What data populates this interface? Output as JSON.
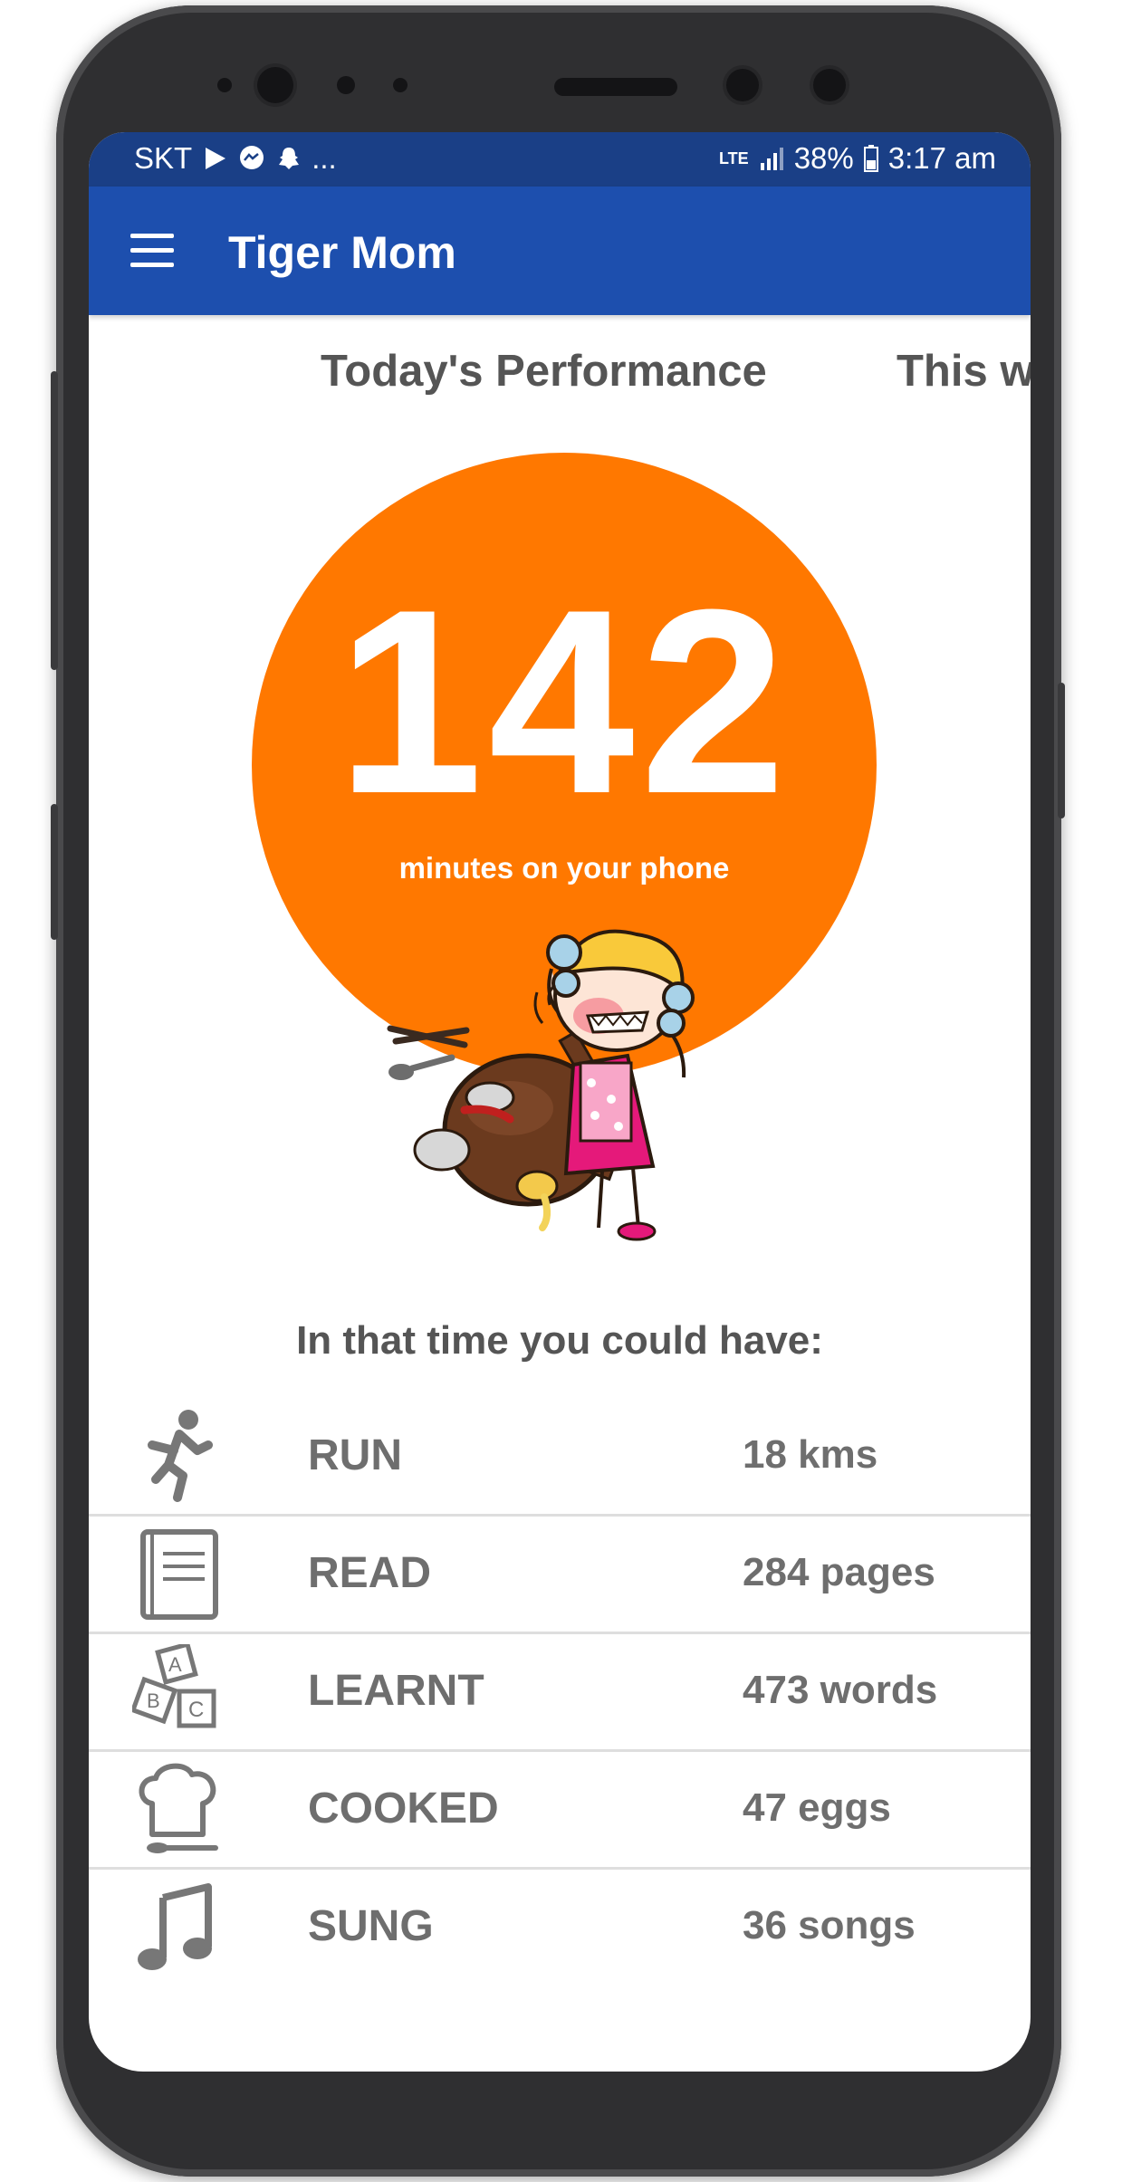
{
  "status_bar": {
    "carrier": "SKT",
    "overflow": "...",
    "network": "LTE",
    "battery": "38%",
    "time": "3:17 am",
    "icons": [
      "play-store-icon",
      "messenger-icon",
      "snapchat-icon",
      "signal-icon",
      "battery-icon"
    ]
  },
  "app_bar": {
    "title": "Tiger Mom",
    "menu_icon": "hamburger-menu-icon"
  },
  "tabs": [
    {
      "label": "Today's Performance",
      "selected": true
    },
    {
      "label": "This w",
      "selected": false
    }
  ],
  "summary": {
    "minutes": "142",
    "caption": "minutes on your phone"
  },
  "illustration": {
    "icon": "angry-mom-flipping-table-illustration"
  },
  "could_have_heading": "In that time you could have:",
  "activities": [
    {
      "label": "RUN",
      "value": "18 kms",
      "icon": "running-person-icon"
    },
    {
      "label": "READ",
      "value": "284 pages",
      "icon": "book-icon"
    },
    {
      "label": "LEARNT",
      "value": "473 words",
      "icon": "abc-blocks-icon"
    },
    {
      "label": "COOKED",
      "value": "47 eggs",
      "icon": "chef-hat-icon"
    },
    {
      "label": "SUNG",
      "value": "36 songs",
      "icon": "music-note-icon"
    }
  ],
  "colors": {
    "status_bar": "#1a3f86",
    "app_bar": "#1d4fae",
    "accent_orange": "#ff7800",
    "text_gray": "#6e6e6e"
  }
}
